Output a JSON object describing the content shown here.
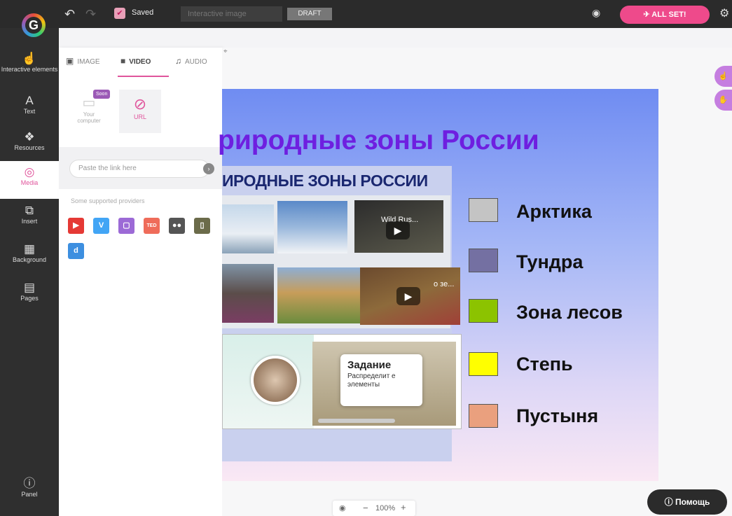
{
  "topbar": {
    "saved_label": "Saved",
    "title_placeholder": "Interactive image",
    "draft_label": "DRAFT",
    "allset_label": "ALL SET!",
    "icons": [
      "undo-icon",
      "redo-icon",
      "check-icon",
      "eye-icon",
      "settings-icon"
    ]
  },
  "sidebar": {
    "items": [
      {
        "label": "Interactive elements",
        "icon": "touch-icon"
      },
      {
        "label": "Text",
        "icon": "text-icon"
      },
      {
        "label": "Resources",
        "icon": "resources-icon"
      },
      {
        "label": "Media",
        "icon": "camera-icon",
        "active": true
      },
      {
        "label": "Insert",
        "icon": "insert-icon"
      },
      {
        "label": "Background",
        "icon": "background-icon"
      },
      {
        "label": "Pages",
        "icon": "pages-icon"
      }
    ],
    "panel_label": "Panel"
  },
  "media_panel": {
    "tabs": [
      "IMAGE",
      "VIDEO",
      "AUDIO"
    ],
    "active_tab": "VIDEO",
    "option_computer": "Your computer",
    "soon_badge": "Soon",
    "option_url": "URL",
    "paste_placeholder": "Paste the link here",
    "providers_label": "Some supported providers",
    "providers": [
      "youtube",
      "vimeo",
      "twitch",
      "ted",
      "flickr",
      "slideshare",
      "dailymotion"
    ]
  },
  "slide": {
    "title": "риродные зоны России",
    "inner_title": "ИРОДНЫЕ ЗОНЫ РОССИИ",
    "video1_title": "Wild Rus...",
    "video2_title": "о зе...",
    "task_title": "Задание",
    "task_text": "Распределит е элементы",
    "legend": [
      {
        "label": "Арктика",
        "color": "#c4c4c4"
      },
      {
        "label": "Тундра",
        "color": "#7470a2"
      },
      {
        "label": "Зона лесов",
        "color": "#8cc300"
      },
      {
        "label": "Степь",
        "color": "#ffff00"
      },
      {
        "label": "Пустыня",
        "color": "#eaa07e"
      }
    ]
  },
  "zoom": {
    "label": "100%"
  },
  "help_label": "Помощь"
}
